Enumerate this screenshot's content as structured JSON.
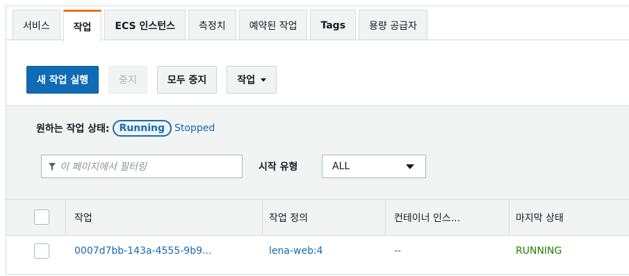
{
  "tabs": [
    {
      "label": "서비스",
      "active": false
    },
    {
      "label": "작업",
      "active": true
    },
    {
      "label": "ECS 인스턴스",
      "active": false
    },
    {
      "label": "측정치",
      "active": false
    },
    {
      "label": "예약된 작업",
      "active": false
    },
    {
      "label": "Tags",
      "active": false
    },
    {
      "label": "용량 공급자",
      "active": false
    }
  ],
  "toolbar": {
    "run_task_label": "새 작업 실행",
    "stop_label": "중지",
    "stop_all_label": "모두 중지",
    "actions_label": "작업"
  },
  "status_filter": {
    "label": "원하는 작업 상태:",
    "running_label": "Running",
    "stopped_label": "Stopped"
  },
  "filter": {
    "placeholder": "이 페이지에서 필터링"
  },
  "launch_type": {
    "label": "시작 유형",
    "value": "ALL"
  },
  "table": {
    "columns": [
      "작업",
      "작업 정의",
      "컨테이너 인스...",
      "마지막 상태"
    ],
    "rows": [
      {
        "task": "0007d7bb-143a-4555-9b9...",
        "task_definition": "lena-web:4",
        "container_instance": "--",
        "last_status": "RUNNING"
      }
    ]
  },
  "colors": {
    "accent": "#ec7211",
    "primary": "#0f6bb4",
    "running": "#1d8102"
  }
}
